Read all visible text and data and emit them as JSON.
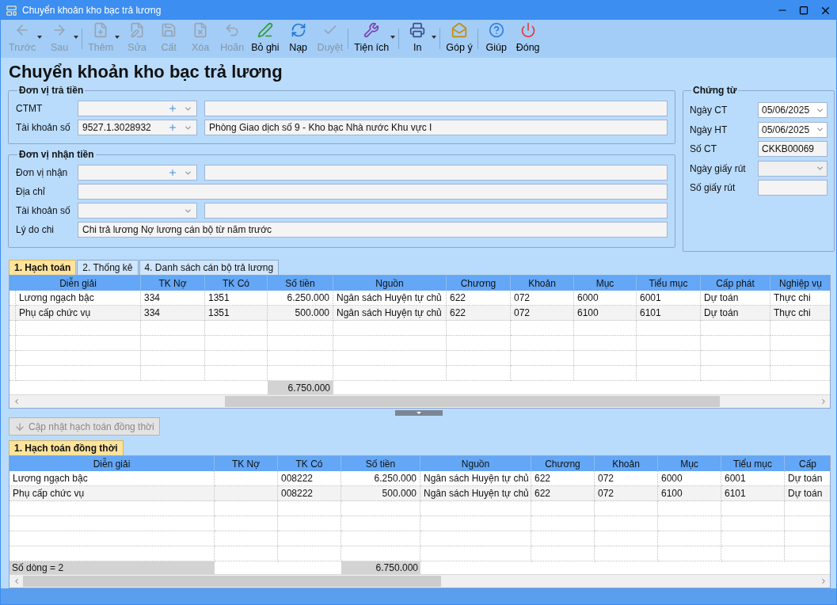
{
  "window": {
    "title": "Chuyển khoản kho bạc trả lương"
  },
  "toolbar": [
    {
      "label": "Trước",
      "kind": "back",
      "disabled": true,
      "dropdown": true,
      "separator_before": false
    },
    {
      "label": "Sau",
      "kind": "forward",
      "disabled": true,
      "dropdown": true,
      "separator_before": false
    },
    {
      "label": "Thêm",
      "kind": "new",
      "disabled": true,
      "dropdown": true,
      "separator_before": true
    },
    {
      "label": "Sửa",
      "kind": "edit",
      "disabled": true,
      "dropdown": false,
      "separator_before": false
    },
    {
      "label": "Cất",
      "kind": "save",
      "disabled": true,
      "dropdown": false,
      "separator_before": false
    },
    {
      "label": "Xóa",
      "kind": "delete",
      "disabled": true,
      "dropdown": false,
      "separator_before": false
    },
    {
      "label": "Hoãn",
      "kind": "undo",
      "disabled": true,
      "dropdown": false,
      "separator_before": false
    },
    {
      "label": "Bỏ ghi",
      "kind": "unpost",
      "disabled": false,
      "dropdown": false,
      "separator_before": false
    },
    {
      "label": "Nạp",
      "kind": "reload",
      "disabled": false,
      "dropdown": false,
      "separator_before": false
    },
    {
      "label": "Duyệt",
      "kind": "approve",
      "disabled": true,
      "dropdown": false,
      "separator_before": false
    },
    {
      "label": "Tiện ích",
      "kind": "tools",
      "disabled": false,
      "dropdown": true,
      "separator_before": true
    },
    {
      "label": "In",
      "kind": "print",
      "disabled": false,
      "dropdown": true,
      "separator_before": true
    },
    {
      "label": "Góp ý",
      "kind": "feedback",
      "disabled": false,
      "dropdown": false,
      "separator_before": true
    },
    {
      "label": "Giúp",
      "kind": "help",
      "disabled": false,
      "dropdown": false,
      "separator_before": true
    },
    {
      "label": "Đóng",
      "kind": "close",
      "disabled": false,
      "dropdown": false,
      "separator_before": false
    }
  ],
  "page_title": "Chuyển khoản kho bạc trả lương",
  "payer": {
    "title": "Đơn vị trả tiền",
    "fields": [
      {
        "label": "CTMT",
        "kind": "lookup"
      },
      {
        "label": "Tài khoản số",
        "kind": "lookup",
        "value": "9527.1.3028932",
        "detail": "Phòng Giao dịch số 9 - Kho bạc Nhà nước Khu vực I"
      }
    ]
  },
  "payee": {
    "title": "Đơn vị nhận tiền",
    "fields": [
      {
        "label": "Đơn vị nhận",
        "kind": "lookup"
      },
      {
        "label": "Địa chỉ",
        "kind": "text"
      },
      {
        "label": "Tài khoản số",
        "kind": "combo"
      },
      {
        "label": "Lý do chi",
        "kind": "text",
        "value": "Chi trả lương Nợ lương cán bộ từ năm trước"
      }
    ]
  },
  "voucher": {
    "title": "Chứng từ",
    "fields": [
      {
        "label": "Ngày CT",
        "kind": "date",
        "value": "05/06/2025"
      },
      {
        "label": "Ngày HT",
        "kind": "date",
        "value": "05/06/2025"
      },
      {
        "label": "Số CT",
        "kind": "text",
        "value": "CKKB00069"
      },
      {
        "label": "Ngày giấy rút",
        "kind": "date"
      },
      {
        "label": "Số giấy rút",
        "kind": "text"
      }
    ]
  },
  "tabs": [
    {
      "label": "1. Hạch toán",
      "selected": true
    },
    {
      "label": "2. Thống kê",
      "selected": false
    },
    {
      "label": "4. Danh sách cán bộ trả lương",
      "selected": false
    }
  ],
  "grid": {
    "columns": [
      "Diễn giải",
      "TK Nợ",
      "TK Có",
      "Số tiền",
      "Nguồn",
      "Chương",
      "Khoản",
      "Mục",
      "Tiểu mục",
      "Cấp phát",
      "Nghiệp vụ"
    ],
    "rows": [
      [
        "Lương ngạch bậc",
        "334",
        "1351",
        "6.250.000",
        "Ngân sách Huyện tự chủ",
        "622",
        "072",
        "6000",
        "6001",
        "Dự toán",
        "Thực chi"
      ],
      [
        "Phụ cấp chức vụ",
        "334",
        "1351",
        "500.000",
        "Ngân sách Huyện tự chủ",
        "622",
        "072",
        "6100",
        "6101",
        "Dự toán",
        "Thực chi"
      ]
    ],
    "total": "6.750.000"
  },
  "update_button": {
    "label": "Cập nhật hạch toán đồng thời",
    "disabled": true
  },
  "tabs_2": [
    {
      "label": "1. Hạch toán đồng thời",
      "selected": true
    }
  ],
  "grid_2": {
    "columns": [
      "Diễn giải",
      "TK Nợ",
      "TK Có",
      "Số tiền",
      "Nguồn",
      "Chương",
      "Khoản",
      "Mục",
      "Tiểu mục",
      "Cấp"
    ],
    "rows": [
      [
        "Lương ngạch bậc",
        null,
        "008222",
        "6.250.000",
        "Ngân sách Huyện tự chủ",
        "622",
        "072",
        "6000",
        "6001",
        "Dự toán"
      ],
      [
        "Phụ cấp chức vụ",
        null,
        "008222",
        "500.000",
        "Ngân sách Huyện tự chủ",
        "622",
        "072",
        "6100",
        "6101",
        "Dự toán"
      ]
    ],
    "row_count": "Số dòng = 2",
    "total": "6.750.000"
  }
}
